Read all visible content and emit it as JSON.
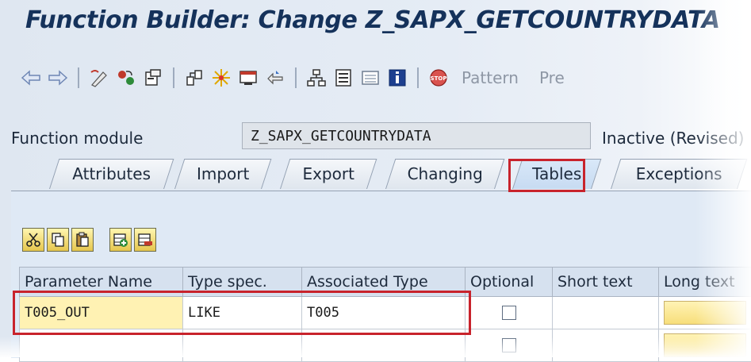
{
  "window": {
    "title": "Function Builder: Change Z_SAPX_GETCOUNTRYDATA"
  },
  "toolbar": {
    "pattern_label": "Pattern",
    "pretty_label": "Pre",
    "icons": [
      "back-arrow-icon",
      "forward-arrow-icon",
      "display-change-icon",
      "activate-icon",
      "other-object-icon",
      "check-icon",
      "where-used-icon",
      "test-icon",
      "jump-icon",
      "hierarchy-icon",
      "overview-icon",
      "list-icon",
      "info-icon",
      "stop-breakpoint-icon"
    ]
  },
  "function_module": {
    "label": "Function module",
    "value": "Z_SAPX_GETCOUNTRYDATA",
    "status": "Inactive (Revised)"
  },
  "tabs": [
    {
      "label": "Attributes"
    },
    {
      "label": "Import"
    },
    {
      "label": "Export"
    },
    {
      "label": "Changing"
    },
    {
      "label": "Tables",
      "active": true
    },
    {
      "label": "Exceptions"
    }
  ],
  "table_toolbar": {
    "icons": [
      "cut-icon",
      "copy-icon",
      "paste-icon",
      "insert-row-icon",
      "delete-row-icon"
    ]
  },
  "grid": {
    "columns": [
      "Parameter Name",
      "Type spec.",
      "Associated Type",
      "Optional",
      "Short text",
      "Long text"
    ],
    "rows": [
      {
        "parameter_name": "T005_OUT",
        "type_spec": "LIKE",
        "associated_type": "T005",
        "optional": false,
        "short_text": ""
      },
      {
        "parameter_name": "",
        "type_spec": "",
        "associated_type": "",
        "optional": false,
        "short_text": ""
      }
    ]
  },
  "colors": {
    "title": "#15325b",
    "highlight": "#c8232c",
    "active_tab": "#c7dbf2"
  }
}
